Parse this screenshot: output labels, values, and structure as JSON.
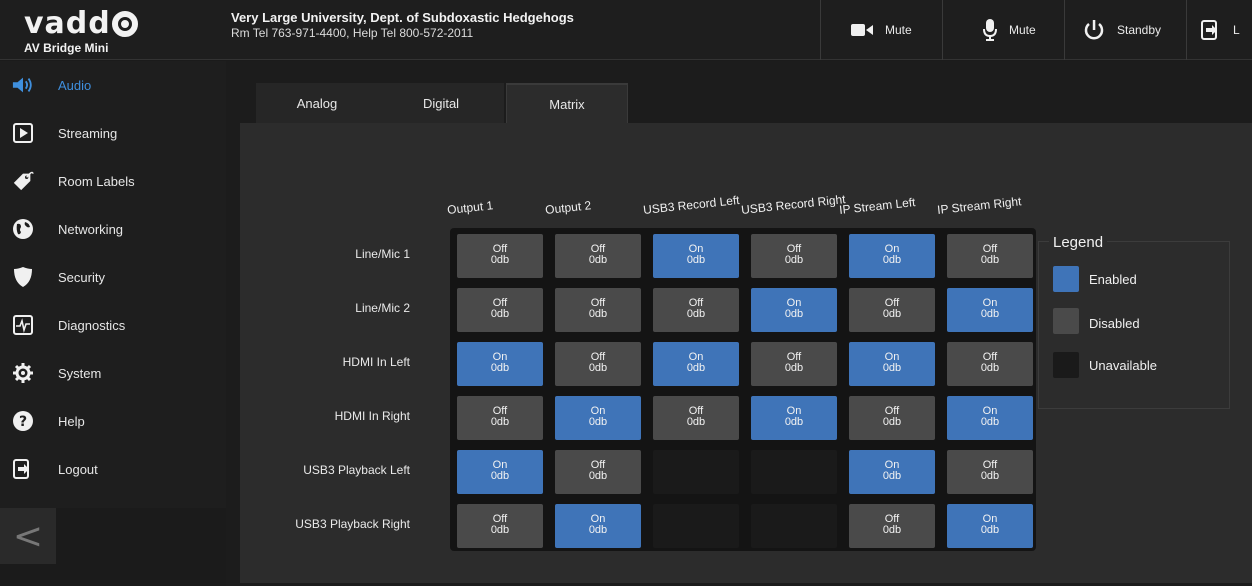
{
  "header": {
    "logo": "vadd",
    "product": "AV Bridge Mini",
    "site_name": "Very Large University, Dept. of Subdoxastic Hedgehogs",
    "site_phone": "Rm Tel 763-971-4400, Help Tel 800-572-2011",
    "video_mute_label": "Mute",
    "audio_mute_label": "Mute",
    "standby_label": "Standby",
    "logout_label": "L"
  },
  "sidebar": {
    "items": [
      {
        "label": "Audio",
        "icon": "speaker-icon",
        "active": true
      },
      {
        "label": "Streaming",
        "icon": "play-icon"
      },
      {
        "label": "Room Labels",
        "icon": "tag-icon"
      },
      {
        "label": "Networking",
        "icon": "globe-icon"
      },
      {
        "label": "Security",
        "icon": "shield-icon"
      },
      {
        "label": "Diagnostics",
        "icon": "pulse-icon"
      },
      {
        "label": "System",
        "icon": "gear-icon"
      },
      {
        "label": "Help",
        "icon": "question-icon"
      },
      {
        "label": "Logout",
        "icon": "logout-icon"
      }
    ],
    "collapse_glyph": "<"
  },
  "tabs": [
    {
      "label": "Analog"
    },
    {
      "label": "Digital"
    },
    {
      "label": "Matrix",
      "active": true
    }
  ],
  "matrix": {
    "columns": [
      "Output 1",
      "Output 2",
      "USB3 Record Left",
      "USB3 Record Right",
      "IP Stream Left",
      "IP Stream Right"
    ],
    "rows": [
      {
        "label": "Line/Mic 1",
        "cells": [
          {
            "state": "Off",
            "gain": "0db"
          },
          {
            "state": "Off",
            "gain": "0db"
          },
          {
            "state": "On",
            "gain": "0db"
          },
          {
            "state": "Off",
            "gain": "0db"
          },
          {
            "state": "On",
            "gain": "0db"
          },
          {
            "state": "Off",
            "gain": "0db"
          }
        ]
      },
      {
        "label": "Line/Mic 2",
        "cells": [
          {
            "state": "Off",
            "gain": "0db"
          },
          {
            "state": "Off",
            "gain": "0db"
          },
          {
            "state": "Off",
            "gain": "0db"
          },
          {
            "state": "On",
            "gain": "0db"
          },
          {
            "state": "Off",
            "gain": "0db"
          },
          {
            "state": "On",
            "gain": "0db"
          }
        ]
      },
      {
        "label": "HDMI In Left",
        "cells": [
          {
            "state": "On",
            "gain": "0db"
          },
          {
            "state": "Off",
            "gain": "0db"
          },
          {
            "state": "On",
            "gain": "0db"
          },
          {
            "state": "Off",
            "gain": "0db"
          },
          {
            "state": "On",
            "gain": "0db"
          },
          {
            "state": "Off",
            "gain": "0db"
          }
        ]
      },
      {
        "label": "HDMI In Right",
        "cells": [
          {
            "state": "Off",
            "gain": "0db"
          },
          {
            "state": "On",
            "gain": "0db"
          },
          {
            "state": "Off",
            "gain": "0db"
          },
          {
            "state": "On",
            "gain": "0db"
          },
          {
            "state": "Off",
            "gain": "0db"
          },
          {
            "state": "On",
            "gain": "0db"
          }
        ]
      },
      {
        "label": "USB3 Playback Left",
        "cells": [
          {
            "state": "On",
            "gain": "0db"
          },
          {
            "state": "Off",
            "gain": "0db"
          },
          {
            "state": "NA"
          },
          {
            "state": "NA"
          },
          {
            "state": "On",
            "gain": "0db"
          },
          {
            "state": "Off",
            "gain": "0db"
          }
        ]
      },
      {
        "label": "USB3 Playback Right",
        "cells": [
          {
            "state": "Off",
            "gain": "0db"
          },
          {
            "state": "On",
            "gain": "0db"
          },
          {
            "state": "NA"
          },
          {
            "state": "NA"
          },
          {
            "state": "Off",
            "gain": "0db"
          },
          {
            "state": "On",
            "gain": "0db"
          }
        ]
      }
    ]
  },
  "legend": {
    "title": "Legend",
    "items": [
      {
        "label": "Enabled",
        "color": "#3f74b8"
      },
      {
        "label": "Disabled",
        "color": "#4a4a4a"
      },
      {
        "label": "Unavailable",
        "color": "#1a1a1a"
      }
    ]
  },
  "colors": {
    "accent": "#3f8fdd",
    "enabled": "#3f74b8",
    "disabled": "#4a4a4a"
  }
}
